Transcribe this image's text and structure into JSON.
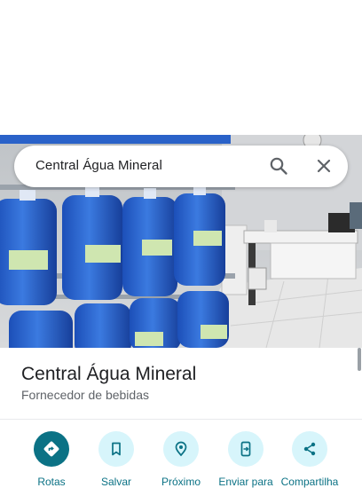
{
  "search": {
    "query": "Central Água Mineral"
  },
  "place": {
    "name": "Central Água Mineral",
    "category": "Fornecedor de bebidas"
  },
  "actions": [
    {
      "label": "Rotas",
      "icon": "directions-icon"
    },
    {
      "label": "Salvar",
      "icon": "bookmark-icon"
    },
    {
      "label": "Próximo",
      "icon": "nearby-icon"
    },
    {
      "label": "Enviar para",
      "icon": "send-to-phone-icon"
    },
    {
      "label": "Compartilha",
      "icon": "share-icon"
    }
  ],
  "colors": {
    "accent": "#0b7285",
    "action_bg": "#d7f5fb",
    "title": "#202124",
    "secondary": "#5f6368"
  }
}
